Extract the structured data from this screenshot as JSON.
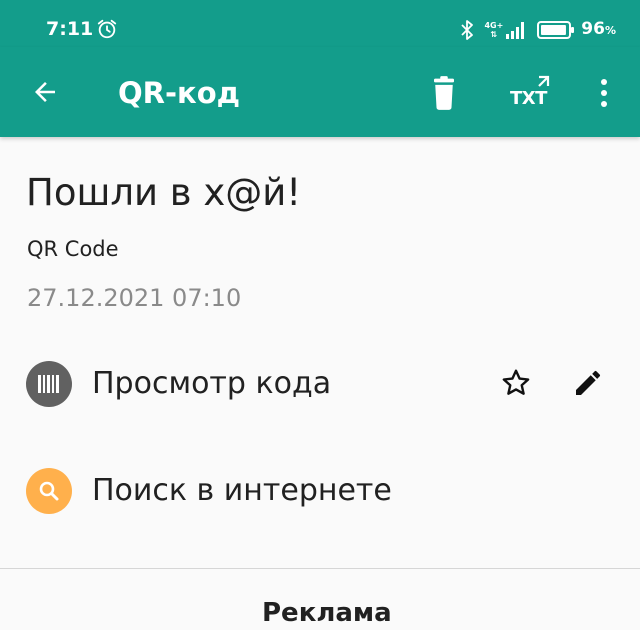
{
  "status_bar": {
    "time": "7:11",
    "network": "4G+",
    "battery_percent": "96",
    "battery_unit": "%",
    "battery_level": 0.96
  },
  "toolbar": {
    "title": "QR-код",
    "txt_label": "TXT",
    "color": "#139d8b"
  },
  "record": {
    "content": "Пошли в х@й!",
    "format": "QR Code",
    "timestamp": "27.12.2021 07:10"
  },
  "actions": {
    "view_code": {
      "label": "Просмотр кода",
      "icon": "barcode-icon",
      "color": "#616161"
    },
    "web_search": {
      "label": "Поиск в интернете",
      "icon": "search-icon",
      "color": "#ffb04c"
    }
  },
  "ad": {
    "label": "Реклама"
  }
}
